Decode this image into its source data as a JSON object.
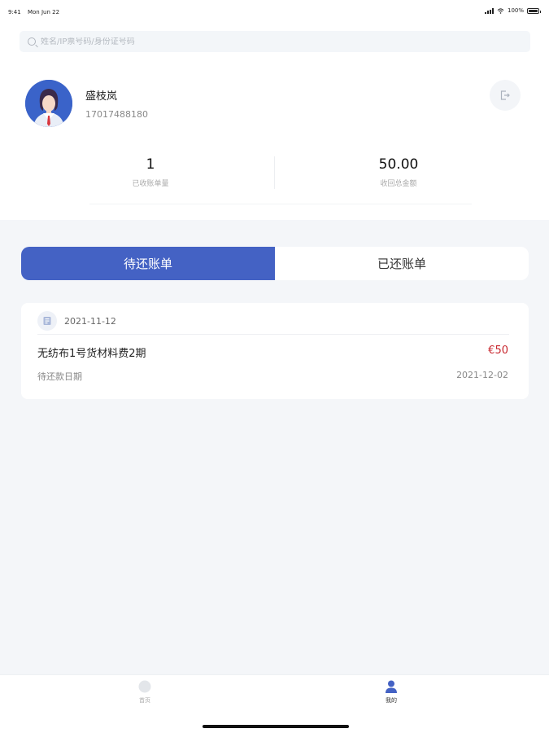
{
  "status_bar": {
    "time": "9:41",
    "date": "Mon Jun 22",
    "battery": "100%"
  },
  "search": {
    "placeholder": "姓名/IP票号码/身份证号码"
  },
  "profile": {
    "name": "盛枝岚",
    "phone": "17017488180"
  },
  "stats": [
    {
      "value": "1",
      "label": "已收账单量"
    },
    {
      "value": "50.00",
      "label": "收回总金额"
    }
  ],
  "tabs": [
    {
      "label": "待还账单",
      "active": true
    },
    {
      "label": "已还账单",
      "active": false
    }
  ],
  "bill": {
    "date": "2021-11-12",
    "title": "无纺布1号货材料费2期",
    "amount": "€50",
    "due_label": "待还款日期",
    "due_date": "2021-12-02"
  },
  "bottom_nav": [
    {
      "label": "首页",
      "icon": "home-icon",
      "active": false
    },
    {
      "label": "我的",
      "icon": "user-icon",
      "active": true
    }
  ],
  "colors": {
    "accent": "#4462c4",
    "amount": "#c8262d",
    "background": "#f4f6f9"
  }
}
